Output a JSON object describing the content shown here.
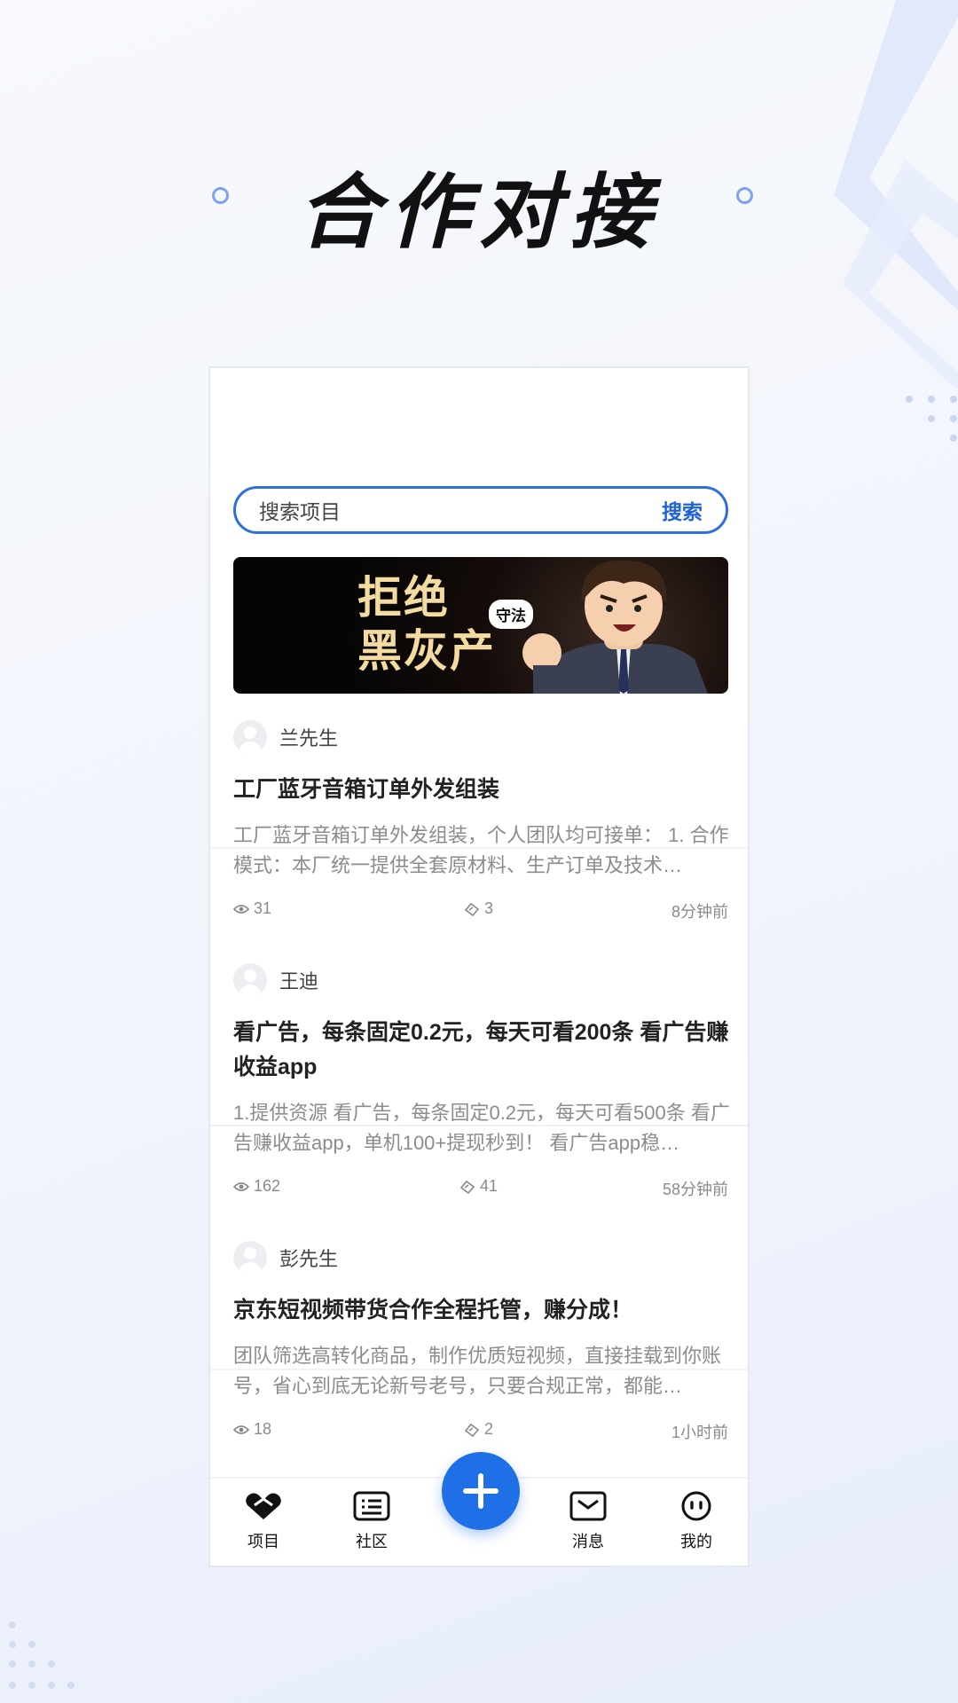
{
  "hero": {
    "title": "合作对接"
  },
  "search": {
    "placeholder": "搜索项目",
    "button": "搜索"
  },
  "banner": {
    "text_line1": "拒绝",
    "text_line2": "黑灰产",
    "bubble": "守法"
  },
  "posts": [
    {
      "author": "兰先生",
      "title": "工厂蓝牙音箱订单外发组装",
      "desc": "工厂蓝牙音箱订单外发组装，个人团队均可接单： 1. 合作模式：本厂统一提供全套原材料、生产订单及技术…",
      "views": "31",
      "likes": "3",
      "time": "8分钟前"
    },
    {
      "author": "王迪",
      "title": "看广告，每条固定0.2元，每天可看200条 看广告赚收益app",
      "desc": "1.提供资源 看广告，每条固定0.2元，每天可看500条 看广告赚收益app，单机100+提现秒到！ 看广告app稳…",
      "views": "162",
      "likes": "41",
      "time": "58分钟前"
    },
    {
      "author": "彭先生",
      "title": "京东短视频带货合作全程托管，赚分成！",
      "desc": "团队筛选高转化商品，制作优质短视频，直接挂载到你账号，省心到底无论新号老号，只要合规正常，都能…",
      "views": "18",
      "likes": "2",
      "time": "1小时前"
    }
  ],
  "tabs": {
    "project": "项目",
    "community": "社区",
    "message": "消息",
    "mine": "我的"
  },
  "colors": {
    "accent": "#1f6fe6",
    "search_border": "#2e6fde"
  }
}
